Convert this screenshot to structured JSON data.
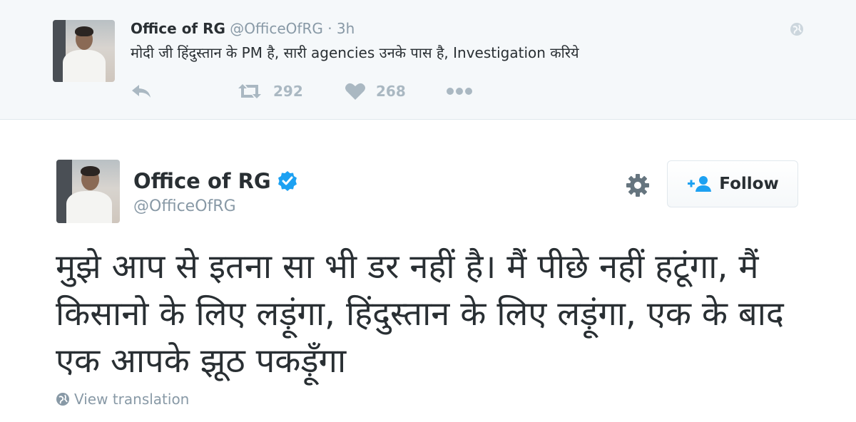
{
  "top_tweet": {
    "author_name": "Office of RG",
    "handle": "@OfficeOfRG",
    "separator": "·",
    "time": "3h",
    "text": "मोदी जी हिंदुस्तान के PM है, सारी agencies उनके पास है, Investigation करिये",
    "retweet_count": "292",
    "like_count": "268",
    "icons": [
      "globe-icon",
      "reply-icon",
      "retweet-icon",
      "heart-icon",
      "more-icon"
    ]
  },
  "main_tweet": {
    "author_name": "Office of RG",
    "handle": "@OfficeOfRG",
    "follow_label": "Follow",
    "text": "मुझे आप से इतना सा भी डर नहीं है। मैं पीछे नहीं हटूंगा, मैं किसानो के लिए लड़ूंगा, हिंदुस्तान के लिए लड़ूंगा, एक के बाद एक आपके झूठ पकड़ूँगा",
    "translate_label": "View translation",
    "icons": [
      "verified-badge-icon",
      "gear-icon",
      "follow-user-icon",
      "globe-icon"
    ]
  },
  "colors": {
    "accent": "#1da1f2",
    "text": "#292f33",
    "muted": "#8899a6",
    "action_gray": "#aab8c2",
    "top_bg": "#f5f8fa"
  }
}
